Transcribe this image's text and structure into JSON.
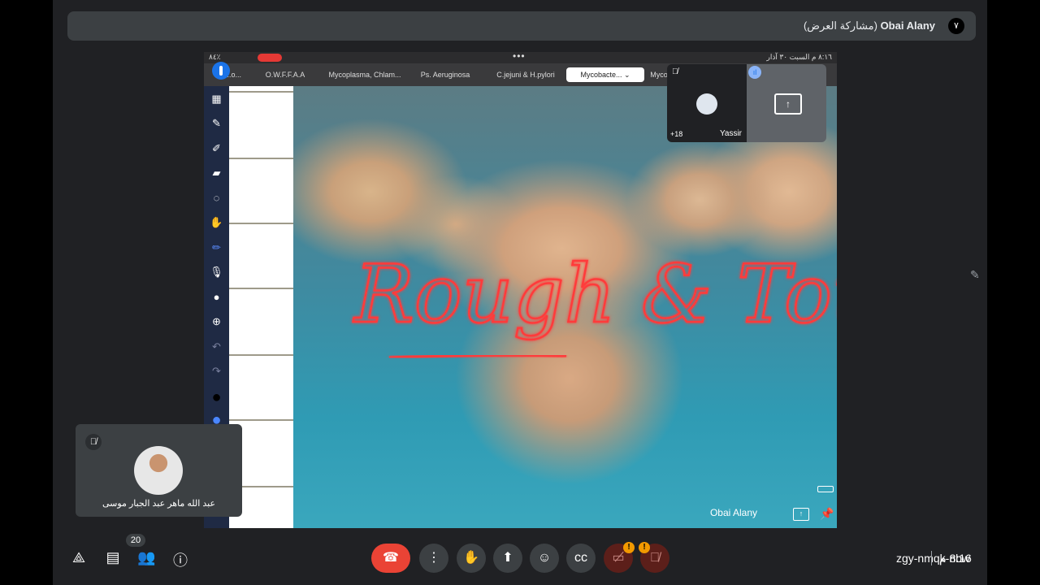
{
  "header": {
    "presenter": "Obai Alany",
    "sharing_suffix": "(مشاركة العرض)",
    "badge": "٧"
  },
  "ipad": {
    "status_time": "٨:١٦ م  السبت ٣٠ آذار",
    "battery": "٨٤٪",
    "tabs": [
      "...o...",
      "O.W.F.F.A.A",
      "Mycoplasma, Chlam...",
      "Ps. Aeruginosa",
      "C.jejuni & H.pylori",
      "Mycobacte...",
      "Myco"
    ],
    "active_tab_index": 5,
    "handwriting": "Rough & Tough"
  },
  "tiles": {
    "remote_name": "Yassir",
    "extra_count": "+18"
  },
  "presenter_label": "Obai Alany",
  "self_tile": {
    "name": "عبد الله ماهر عبد الجبار موسى"
  },
  "bottom": {
    "people_count": "20",
    "meeting_code": "zgy-nmqk-nbw",
    "time": "8:16 م"
  },
  "colors": {
    "accent": "#1a73e8",
    "end_call": "#ea4335",
    "warning": "#f29900",
    "ink": "#ff3b3b"
  }
}
